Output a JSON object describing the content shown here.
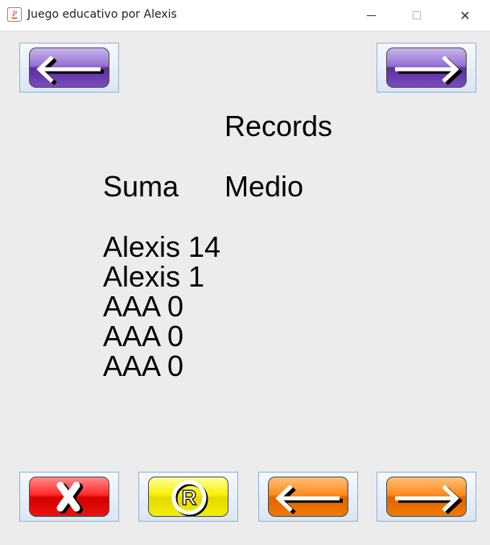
{
  "window": {
    "title": "Juego educativo por Alexis",
    "close_glyph": "✕"
  },
  "content": {
    "heading": "Records",
    "operation": "Suma",
    "level": "Medio",
    "records": [
      {
        "text": "Alexis 14"
      },
      {
        "text": "Alexis 1"
      },
      {
        "text": "AAA 0"
      },
      {
        "text": "AAA 0"
      },
      {
        "text": "AAA 0"
      }
    ]
  },
  "icons": {
    "top_left": "left-arrow-icon",
    "top_right": "right-arrow-icon",
    "exit": "x-icon",
    "records": "registered-icon",
    "prev": "left-arrow-icon",
    "next": "right-arrow-icon"
  },
  "colors": {
    "nav_purple": "#7a4bbd",
    "exit_red": "#ee1010",
    "records_yellow": "#f5ee00",
    "orange": "#f07a00"
  },
  "buttons": {
    "records_glyph": "R"
  }
}
